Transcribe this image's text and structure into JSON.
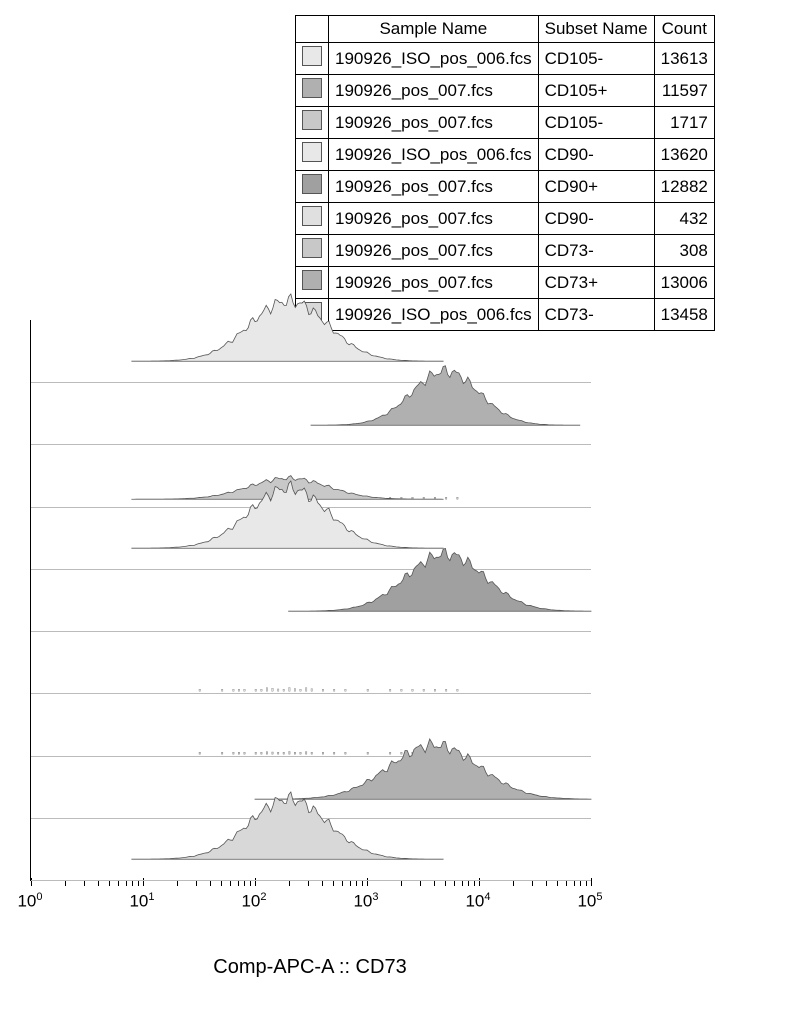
{
  "legend": {
    "headers": [
      "",
      "Sample Name",
      "Subset Name",
      "Count"
    ],
    "rows": [
      {
        "color": "#e8e8e8",
        "sample": "190926_ISO_pos_006.fcs",
        "subset": "CD105-",
        "count": "13613"
      },
      {
        "color": "#b0b0b0",
        "sample": "190926_pos_007.fcs",
        "subset": "CD105+",
        "count": "11597"
      },
      {
        "color": "#c8c8c8",
        "sample": "190926_pos_007.fcs",
        "subset": "CD105-",
        "count": "1717"
      },
      {
        "color": "#e8e8e8",
        "sample": "190926_ISO_pos_006.fcs",
        "subset": "CD90-",
        "count": "13620"
      },
      {
        "color": "#a0a0a0",
        "sample": "190926_pos_007.fcs",
        "subset": "CD90+",
        "count": "12882"
      },
      {
        "color": "#e0e0e0",
        "sample": "190926_pos_007.fcs",
        "subset": "CD90-",
        "count": "432"
      },
      {
        "color": "#c8c8c8",
        "sample": "190926_pos_007.fcs",
        "subset": "CD73-",
        "count": "308"
      },
      {
        "color": "#b0b0b0",
        "sample": "190926_pos_007.fcs",
        "subset": "CD73+",
        "count": "13006"
      },
      {
        "color": "#d8d8d8",
        "sample": "190926_ISO_pos_006.fcs",
        "subset": "CD73-",
        "count": "13458"
      }
    ]
  },
  "axis_label": "Comp-APC-A :: CD73",
  "tick_values": [
    "10^0",
    "10^1",
    "10^2",
    "10^3",
    "10^4",
    "10^5"
  ],
  "chart_data": {
    "type": "histogram-overlay",
    "title": "",
    "xlabel": "Comp-APC-A :: CD73",
    "x_scale": "log10",
    "xlim": [
      1,
      100000
    ],
    "y_metric": "count-density",
    "note": "Nine stacked flow-cytometry histograms (offset baselines). Peak positions in log10(x) units and relative heights estimated visually.",
    "series": [
      {
        "name": "CD105- (ISO 006)",
        "color": "#e8e8e8",
        "count": 13613,
        "peak_log10": 2.3,
        "sigma": 0.35,
        "rel_height": 1.0,
        "lane": 0
      },
      {
        "name": "CD105+ (007)",
        "color": "#b0b0b0",
        "count": 11597,
        "peak_log10": 3.7,
        "sigma": 0.3,
        "rel_height": 0.9,
        "lane": 1
      },
      {
        "name": "CD105- (007)",
        "color": "#c8c8c8",
        "count": 1717,
        "peak_log10": 2.3,
        "sigma": 0.35,
        "rel_height": 0.35,
        "lane": 2,
        "sparse": true
      },
      {
        "name": "CD90- (ISO 006)",
        "color": "#e8e8e8",
        "count": 13620,
        "peak_log10": 2.3,
        "sigma": 0.35,
        "rel_height": 1.0,
        "lane": 3
      },
      {
        "name": "CD90+ (007)",
        "color": "#a0a0a0",
        "count": 12882,
        "peak_log10": 3.7,
        "sigma": 0.35,
        "rel_height": 0.95,
        "lane": 4
      },
      {
        "name": "CD90- (007)",
        "color": "#e0e0e0",
        "count": 432,
        "peak_log10": 2.3,
        "sigma": 0.3,
        "rel_height": 0.08,
        "lane": 5,
        "sparse": true
      },
      {
        "name": "CD73- (007)",
        "color": "#c8c8c8",
        "count": 308,
        "peak_log10": 2.3,
        "sigma": 0.3,
        "rel_height": 0.06,
        "lane": 6,
        "sparse": true
      },
      {
        "name": "CD73+ (007)",
        "color": "#b0b0b0",
        "count": 13006,
        "peak_log10": 3.6,
        "sigma": 0.4,
        "rel_height": 0.9,
        "lane": 7
      },
      {
        "name": "CD73- (ISO 006)",
        "color": "#d8d8d8",
        "count": 13458,
        "peak_log10": 2.3,
        "sigma": 0.35,
        "rel_height": 1.0,
        "lane": 8
      }
    ]
  }
}
